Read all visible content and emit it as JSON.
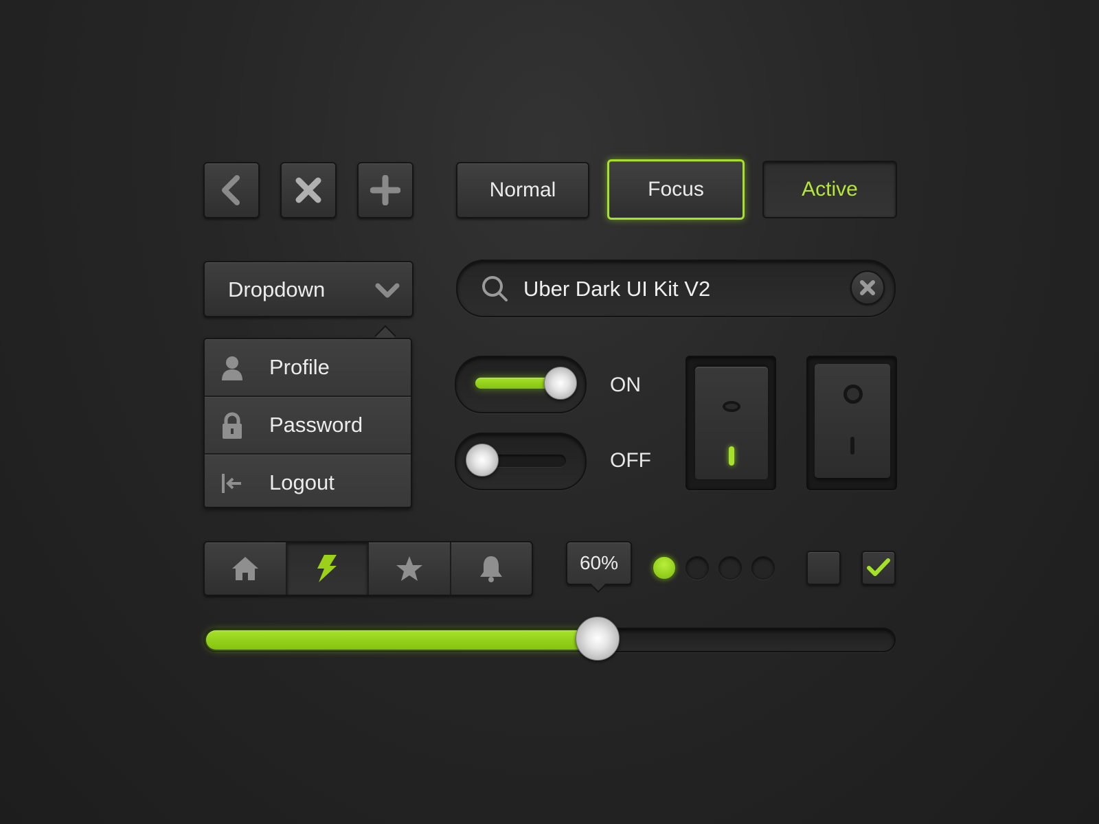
{
  "colors": {
    "accent": "#9bd219",
    "background": "#262626"
  },
  "icon_buttons": [
    {
      "icon": "chevron-left-icon"
    },
    {
      "icon": "close-icon"
    },
    {
      "icon": "plus-icon"
    }
  ],
  "state_buttons": {
    "normal": "Normal",
    "focus": "Focus",
    "active": "Active"
  },
  "dropdown": {
    "label": "Dropdown",
    "icon": "chevron-down-icon",
    "items": [
      {
        "label": "Profile",
        "icon": "user-icon"
      },
      {
        "label": "Password",
        "icon": "lock-icon"
      },
      {
        "label": "Logout",
        "icon": "logout-icon"
      }
    ]
  },
  "search": {
    "value": "Uber Dark UI Kit V2",
    "icon": "search-icon",
    "clear_icon": "clear-icon"
  },
  "toggles": {
    "on_label": "ON",
    "off_label": "OFF"
  },
  "segmented": {
    "items": [
      "home-icon",
      "bolt-icon",
      "star-icon",
      "bell-icon"
    ],
    "selected": "bolt-icon"
  },
  "slider": {
    "value": 0.6,
    "tooltip": "60%"
  },
  "pagination": {
    "count": 4,
    "active_index": 0
  },
  "checkboxes": [
    {
      "checked": false
    },
    {
      "checked": true
    }
  ]
}
